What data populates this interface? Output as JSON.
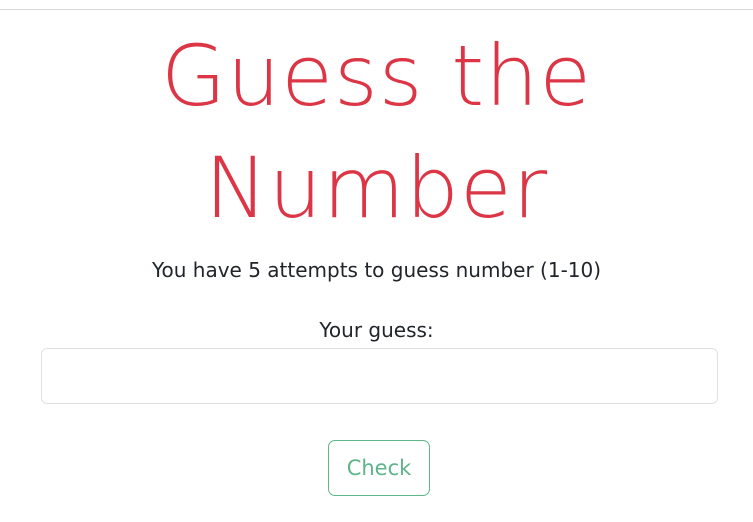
{
  "game": {
    "title_line1": "Guess the",
    "title_line2": "Number",
    "instructions": "You have 5 attempts to guess number (1-10)",
    "guess_label": "Your guess:",
    "guess_value": "",
    "guess_placeholder": "",
    "check_label": "Check"
  },
  "colors": {
    "title": "#dc3545",
    "button": "#5fb48a",
    "text": "#212529"
  }
}
